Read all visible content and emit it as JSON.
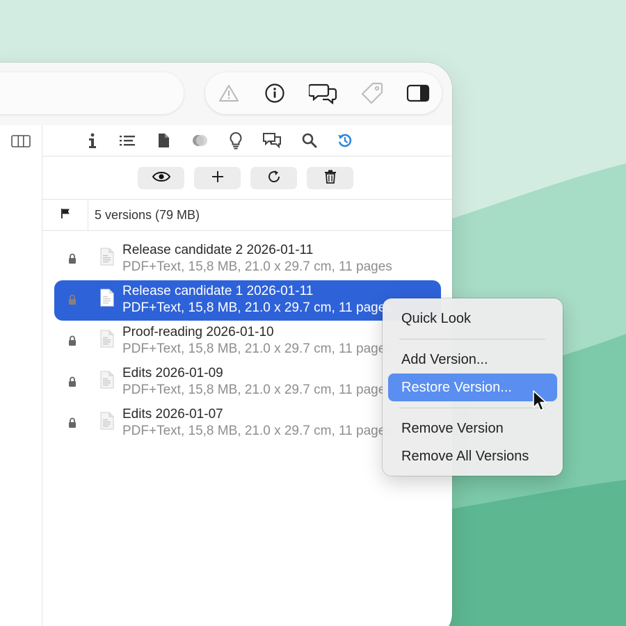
{
  "colors": {
    "accent": "#2e62d8",
    "menu_highlight": "#5a8ef0",
    "refresh_icon": "#2a86e0"
  },
  "toolbar": {
    "icons": [
      "warning-icon",
      "info-icon",
      "comments-icon",
      "tag-icon",
      "sidebar-icon"
    ]
  },
  "inspector_tabs": [
    "info-icon",
    "list-icon",
    "document-icon",
    "circles-icon",
    "lightbulb-icon",
    "chat-icon",
    "search-icon",
    "versions-refresh-icon"
  ],
  "actions": [
    "eye-icon",
    "plus-icon",
    "refresh-icon",
    "trash-icon"
  ],
  "versions": {
    "summary": "5 versions (79 MB)",
    "items": [
      {
        "title": "Release candidate 2 2026-01-11",
        "meta": "PDF+Text, 15,8 MB, 21.0 x 29.7 cm, 11 pages",
        "selected": false
      },
      {
        "title": "Release candidate 1 2026-01-11",
        "meta": "PDF+Text, 15,8 MB, 21.0 x 29.7 cm, 11 pages",
        "selected": true
      },
      {
        "title": "Proof-reading 2026-01-10",
        "meta": "PDF+Text, 15,8 MB, 21.0 x 29.7 cm, 11 pages",
        "selected": false
      },
      {
        "title": "Edits 2026-01-09",
        "meta": "PDF+Text, 15,8 MB, 21.0 x 29.7 cm, 11 pages",
        "selected": false
      },
      {
        "title": "Edits 2026-01-07",
        "meta": "PDF+Text, 15,8 MB, 21.0 x 29.7 cm, 11 pages",
        "selected": false
      }
    ]
  },
  "context_menu": {
    "quick_look": "Quick Look",
    "add_version": "Add Version...",
    "restore_version": "Restore Version...",
    "remove_version": "Remove Version",
    "remove_all": "Remove All Versions"
  }
}
